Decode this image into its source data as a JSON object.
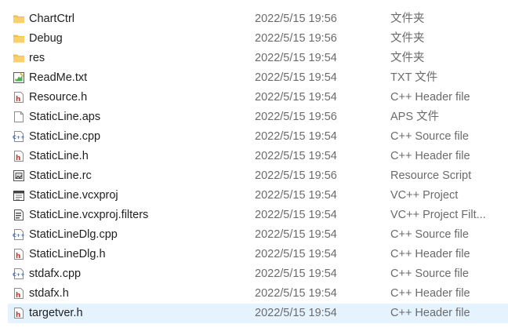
{
  "files": [
    {
      "name": "ChartCtrl",
      "modified": "2022/5/15 19:56",
      "type": "文件夹",
      "icon": "folder-icon"
    },
    {
      "name": "Debug",
      "modified": "2022/5/15 19:56",
      "type": "文件夹",
      "icon": "folder-icon"
    },
    {
      "name": "res",
      "modified": "2022/5/15 19:54",
      "type": "文件夹",
      "icon": "folder-icon"
    },
    {
      "name": "ReadMe.txt",
      "modified": "2022/5/15 19:54",
      "type": "TXT 文件",
      "icon": "text-file-icon"
    },
    {
      "name": "Resource.h",
      "modified": "2022/5/15 19:54",
      "type": "C++ Header file",
      "icon": "header-file-icon"
    },
    {
      "name": "StaticLine.aps",
      "modified": "2022/5/15 19:56",
      "type": "APS 文件",
      "icon": "blank-file-icon"
    },
    {
      "name": "StaticLine.cpp",
      "modified": "2022/5/15 19:54",
      "type": "C++ Source file",
      "icon": "cpp-file-icon"
    },
    {
      "name": "StaticLine.h",
      "modified": "2022/5/15 19:54",
      "type": "C++ Header file",
      "icon": "header-file-icon"
    },
    {
      "name": "StaticLine.rc",
      "modified": "2022/5/15 19:56",
      "type": "Resource Script",
      "icon": "resource-script-icon"
    },
    {
      "name": "StaticLine.vcxproj",
      "modified": "2022/5/15 19:54",
      "type": "VC++ Project",
      "icon": "vcxproj-icon"
    },
    {
      "name": "StaticLine.vcxproj.filters",
      "modified": "2022/5/15 19:54",
      "type": "VC++ Project Filt...",
      "icon": "filters-file-icon"
    },
    {
      "name": "StaticLineDlg.cpp",
      "modified": "2022/5/15 19:54",
      "type": "C++ Source file",
      "icon": "cpp-file-icon"
    },
    {
      "name": "StaticLineDlg.h",
      "modified": "2022/5/15 19:54",
      "type": "C++ Header file",
      "icon": "header-file-icon"
    },
    {
      "name": "stdafx.cpp",
      "modified": "2022/5/15 19:54",
      "type": "C++ Source file",
      "icon": "cpp-file-icon"
    },
    {
      "name": "stdafx.h",
      "modified": "2022/5/15 19:54",
      "type": "C++ Header file",
      "icon": "header-file-icon"
    },
    {
      "name": "targetver.h",
      "modified": "2022/5/15 19:54",
      "type": "C++ Header file",
      "icon": "header-file-icon"
    }
  ],
  "selected_file": "targetver.h",
  "colors": {
    "selection_bg": "#e5f3ff",
    "folder": "#f5c04a",
    "header_h": "#c0392b",
    "cpp_blue": "#2f6fc0"
  }
}
